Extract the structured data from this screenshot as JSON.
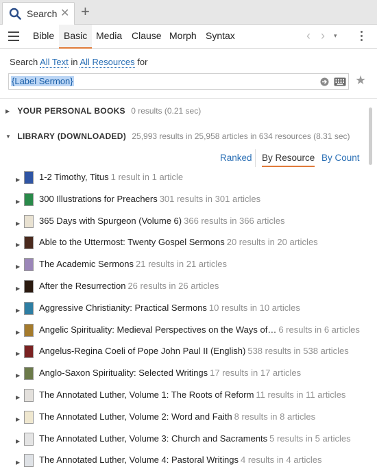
{
  "tab": {
    "label": "Search",
    "close": "✕",
    "new_tab": "+"
  },
  "toolbar": {
    "modes": [
      "Bible",
      "Basic",
      "Media",
      "Clause",
      "Morph",
      "Syntax"
    ],
    "active_mode": "Basic",
    "back": "‹",
    "forward": "›",
    "dropdown": "▾"
  },
  "search": {
    "prefix": "Search",
    "scope_text": "All Text",
    "in": "in",
    "scope_resources": "All Resources",
    "for": "for",
    "query": "{Label Sermon}"
  },
  "sections": {
    "personal": {
      "title": "YOUR PERSONAL BOOKS",
      "meta": "0 results (0.21 sec)"
    },
    "library": {
      "title": "LIBRARY (DOWNLOADED)",
      "meta": "25,993 results in 25,958 articles in 634 resources (8.31 sec)"
    }
  },
  "sort": {
    "ranked": "Ranked",
    "by_resource": "By Resource",
    "by_count": "By Count",
    "active": "By Resource"
  },
  "results": [
    {
      "title": "1-2 Timothy, Titus",
      "count": "1 result in 1 article",
      "cover": "#2f55a4"
    },
    {
      "title": "300 Illustrations for Preachers",
      "count": "301 results in 301 articles",
      "cover": "#2a8a4a"
    },
    {
      "title": "365 Days with Spurgeon (Volume 6)",
      "count": "366 results in 366 articles",
      "cover": "#e9e2d2"
    },
    {
      "title": "Able to the Uttermost: Twenty Gospel Sermons",
      "count": "20 results in 20 articles",
      "cover": "#4a2a1e"
    },
    {
      "title": "The Academic Sermons",
      "count": "21 results in 21 articles",
      "cover": "#9b86b8"
    },
    {
      "title": "After the Resurrection",
      "count": "26 results in 26 articles",
      "cover": "#2b1a10"
    },
    {
      "title": "Aggressive Christianity: Practical Sermons",
      "count": "10 results in 10 articles",
      "cover": "#2e7ea3"
    },
    {
      "title": "Angelic Spirituality: Medieval Perspectives on the Ways of…",
      "count": "6 results in 6 articles",
      "cover": "#a57b2c"
    },
    {
      "title": "Angelus-Regina Coeli of Pope John Paul II (English)",
      "count": "538 results in 538 articles",
      "cover": "#7a2222"
    },
    {
      "title": "Anglo-Saxon Spirituality: Selected Writings",
      "count": "17 results in 17 articles",
      "cover": "#6b7a4a"
    },
    {
      "title": "The Annotated Luther, Volume 1: The Roots of Reform",
      "count": "11 results in 11 articles",
      "cover": "#e3e0dc"
    },
    {
      "title": "The Annotated Luther, Volume 2: Word and Faith",
      "count": "8 results in 8 articles",
      "cover": "#efe7cf"
    },
    {
      "title": "The Annotated Luther, Volume 3: Church and Sacraments",
      "count": "5 results in 5 articles",
      "cover": "#e4e4e4"
    },
    {
      "title": "The Annotated Luther, Volume 4: Pastoral Writings",
      "count": "4 results in 4 articles",
      "cover": "#dfe2e6"
    }
  ]
}
